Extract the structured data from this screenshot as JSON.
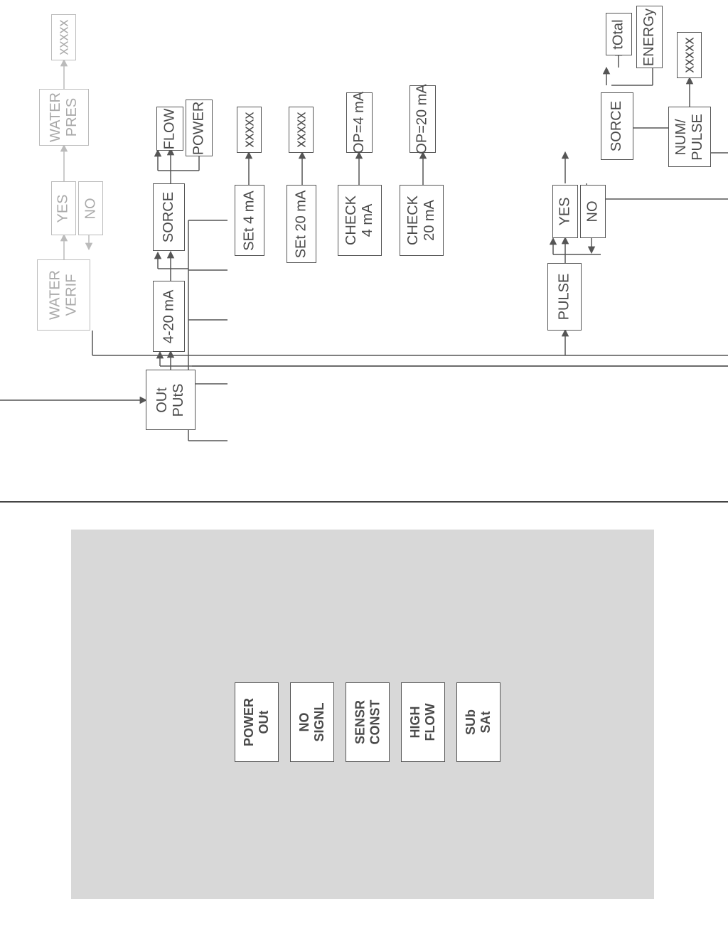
{
  "flow": {
    "outputs": "OUt PUtS",
    "water_verif": "WATER VERIF",
    "yes": "YES",
    "no": "NO",
    "water_pres": "WATER PRES",
    "xxxxx": "xxxxx",
    "four20ma": "4-20 mA",
    "sorce": "SORCE",
    "flow_lbl": "FLOW",
    "power": "POWER",
    "set4": "SEt 4 mA",
    "set20": "SEt 20 mA",
    "check4": "CHECK 4 mA",
    "check20": "CHECK 20 mA",
    "op4": "OP=4 mA",
    "op20": "OP=20 mA",
    "pulse": "PULSE",
    "total": "tOtal",
    "energy": "ENERGy",
    "numpulse": "NUM/ PULSE"
  },
  "errors": {
    "power_out": "POWER OUt",
    "no_signl": "NO SIGNL",
    "sensr_const": "SENSR CONST",
    "high_flow": "HIGH FLOW",
    "sub_sat": "SUb SAt"
  }
}
